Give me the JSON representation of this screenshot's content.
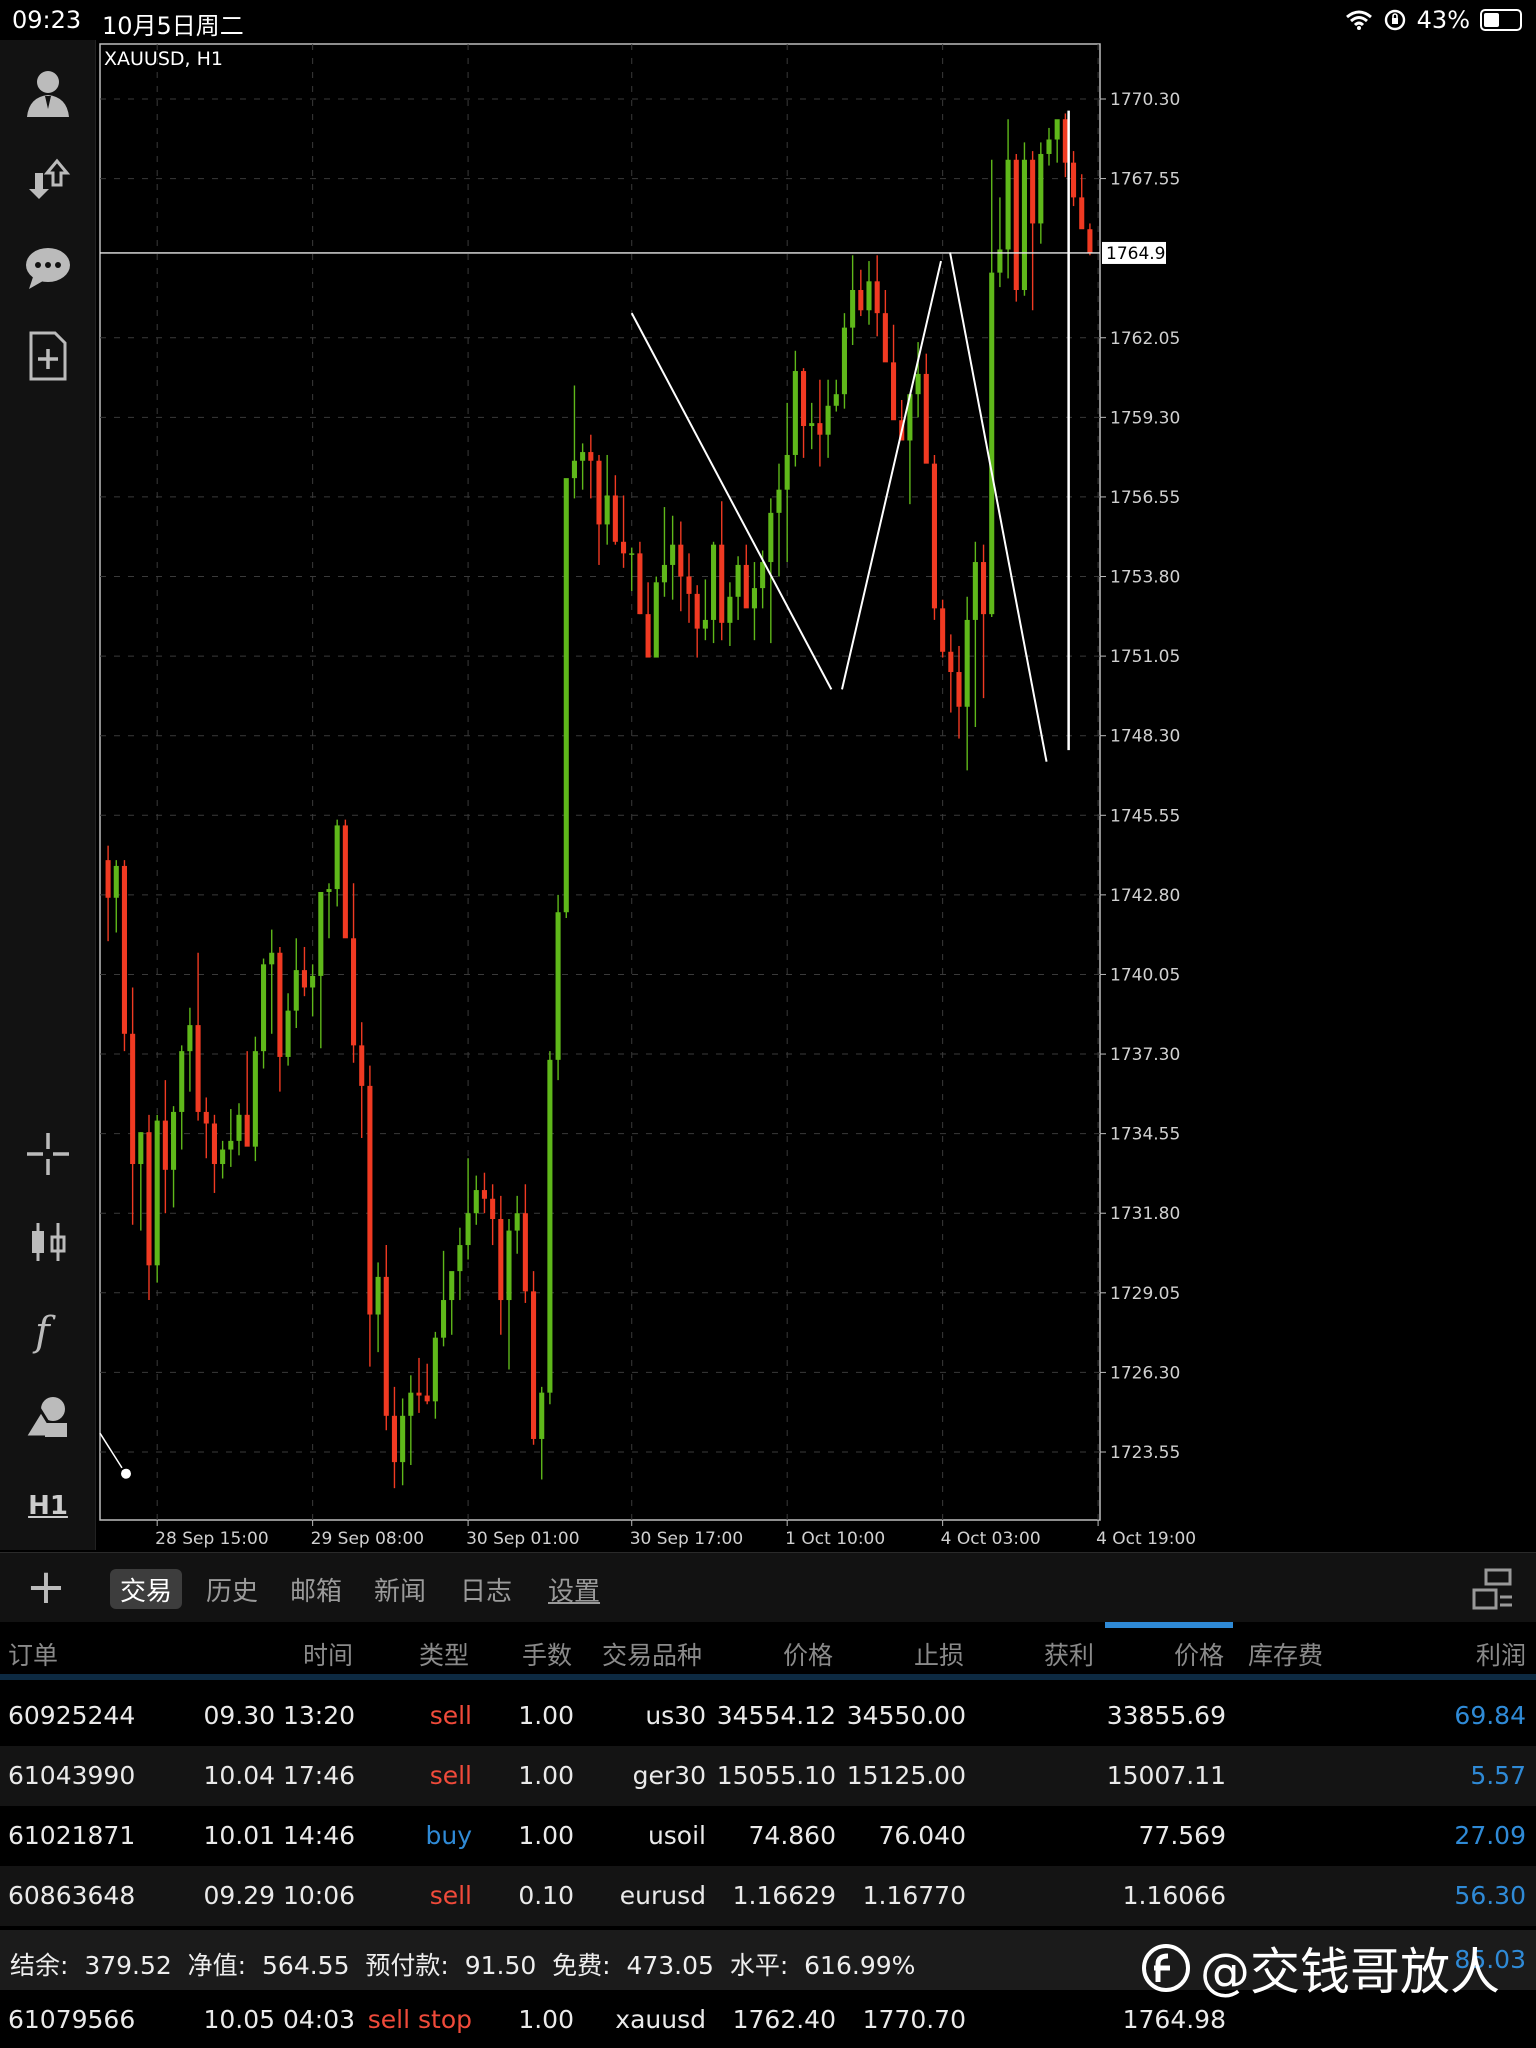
{
  "status_bar": {
    "time": "09:23",
    "date": "10月5日周二",
    "battery": "43%",
    "battery_level": 0.43
  },
  "toolbar": {
    "icons": [
      "account-icon",
      "trade-arrows-icon",
      "chat-icon",
      "new-document-icon",
      "crosshair-icon",
      "chart-type-icon",
      "indicator-icon",
      "objects-icon"
    ],
    "timeframe": "H1"
  },
  "chart": {
    "symbol_label": "XAUUSD, H1",
    "current_price_label": "1764.98"
  },
  "chart_data": {
    "type": "candlestick",
    "symbol": "XAUUSD",
    "timeframe": "H1",
    "y_ticks": [
      "1770.30",
      "1767.55",
      "1764.98",
      "1762.05",
      "1759.30",
      "1756.55",
      "1753.80",
      "1751.05",
      "1748.30",
      "1745.55",
      "1742.80",
      "1740.05",
      "1737.30",
      "1734.55",
      "1731.80",
      "1729.05",
      "1726.30",
      "1723.55"
    ],
    "x_ticks": [
      "28 Sep 15:00",
      "29 Sep 08:00",
      "30 Sep 01:00",
      "30 Sep 17:00",
      "1 Oct 10:00",
      "4 Oct 03:00",
      "4 Oct 19:00"
    ],
    "ylim": [
      1721.2,
      1772.2
    ],
    "current_price": 1764.98,
    "grid": true,
    "colors": {
      "up": "#5fb81a",
      "down": "#f03a22",
      "background": "#000000",
      "grid": "#3a3a3a",
      "axis_text": "#d0d0d0"
    },
    "candles": [
      [
        1744.0,
        1744.5,
        1741.2,
        1742.7
      ],
      [
        1742.7,
        1744.0,
        1741.5,
        1743.8
      ],
      [
        1743.8,
        1744.0,
        1737.4,
        1738.0
      ],
      [
        1738.0,
        1739.6,
        1731.4,
        1733.5
      ],
      [
        1733.5,
        1734.6,
        1731.2,
        1734.6
      ],
      [
        1734.6,
        1735.2,
        1728.8,
        1730.0
      ],
      [
        1730.0,
        1735.2,
        1729.4,
        1735.0
      ],
      [
        1735.0,
        1736.4,
        1731.8,
        1733.3
      ],
      [
        1733.3,
        1735.5,
        1732.0,
        1735.3
      ],
      [
        1735.3,
        1737.6,
        1734.0,
        1737.4
      ],
      [
        1737.4,
        1738.9,
        1736.0,
        1738.3
      ],
      [
        1738.3,
        1740.8,
        1735.0,
        1735.3
      ],
      [
        1735.3,
        1735.8,
        1733.7,
        1734.9
      ],
      [
        1734.9,
        1735.2,
        1732.5,
        1733.5
      ],
      [
        1733.5,
        1734.3,
        1733.0,
        1734.0
      ],
      [
        1734.0,
        1735.4,
        1733.4,
        1734.3
      ],
      [
        1734.3,
        1735.6,
        1733.8,
        1735.2
      ],
      [
        1735.2,
        1737.4,
        1734.7,
        1734.1
      ],
      [
        1734.1,
        1737.9,
        1733.6,
        1737.4
      ],
      [
        1737.4,
        1740.6,
        1736.8,
        1740.4
      ],
      [
        1740.4,
        1741.6,
        1738.0,
        1740.8
      ],
      [
        1740.8,
        1741.0,
        1736.0,
        1737.2
      ],
      [
        1737.2,
        1739.4,
        1736.9,
        1738.8
      ],
      [
        1738.8,
        1741.3,
        1738.2,
        1740.2
      ],
      [
        1740.2,
        1741.0,
        1739.3,
        1739.6
      ],
      [
        1739.6,
        1740.4,
        1738.6,
        1740.0
      ],
      [
        1740.0,
        1742.9,
        1737.5,
        1742.9
      ],
      [
        1742.9,
        1743.2,
        1741.3,
        1743.0
      ],
      [
        1743.0,
        1745.4,
        1742.4,
        1745.2
      ],
      [
        1745.2,
        1745.4,
        1741.7,
        1741.3
      ],
      [
        1741.3,
        1743.2,
        1737.0,
        1737.6
      ],
      [
        1737.6,
        1738.4,
        1734.4,
        1736.2
      ],
      [
        1736.2,
        1736.9,
        1726.5,
        1728.3
      ],
      [
        1728.3,
        1730.1,
        1727.0,
        1729.6
      ],
      [
        1729.6,
        1730.7,
        1724.3,
        1724.8
      ],
      [
        1724.8,
        1725.8,
        1722.3,
        1723.2
      ],
      [
        1723.2,
        1725.4,
        1722.4,
        1724.8
      ],
      [
        1724.8,
        1726.2,
        1723.1,
        1725.6
      ],
      [
        1725.6,
        1726.8,
        1724.9,
        1725.5
      ],
      [
        1725.5,
        1726.6,
        1725.2,
        1725.3
      ],
      [
        1725.3,
        1727.7,
        1724.7,
        1727.5
      ],
      [
        1727.5,
        1730.5,
        1727.2,
        1728.8
      ],
      [
        1728.8,
        1729.5,
        1727.6,
        1729.8
      ],
      [
        1729.8,
        1731.3,
        1728.8,
        1730.7
      ],
      [
        1730.7,
        1733.7,
        1730.2,
        1731.8
      ],
      [
        1731.8,
        1733.1,
        1731.4,
        1732.6
      ],
      [
        1732.6,
        1733.2,
        1731.8,
        1732.3
      ],
      [
        1732.3,
        1732.8,
        1730.7,
        1731.6
      ],
      [
        1731.6,
        1732.4,
        1727.6,
        1728.8
      ],
      [
        1728.8,
        1731.6,
        1726.4,
        1731.2
      ],
      [
        1731.2,
        1732.4,
        1730.4,
        1731.8
      ],
      [
        1731.8,
        1732.8,
        1728.7,
        1729.1
      ],
      [
        1729.1,
        1729.8,
        1723.8,
        1724.0
      ],
      [
        1724.0,
        1725.8,
        1722.6,
        1725.6
      ],
      [
        1725.6,
        1737.4,
        1725.2,
        1737.1
      ],
      [
        1737.1,
        1742.8,
        1736.4,
        1742.2
      ],
      [
        1742.2,
        1757.1,
        1742.0,
        1757.2
      ],
      [
        1757.2,
        1760.4,
        1756.5,
        1757.8
      ],
      [
        1757.8,
        1758.4,
        1756.8,
        1758.1
      ],
      [
        1758.1,
        1758.7,
        1756.5,
        1757.8
      ],
      [
        1757.8,
        1758.0,
        1754.2,
        1755.6
      ],
      [
        1755.6,
        1758.0,
        1754.9,
        1756.6
      ],
      [
        1756.6,
        1757.3,
        1754.9,
        1755.0
      ],
      [
        1755.0,
        1756.6,
        1754.1,
        1754.6
      ],
      [
        1754.6,
        1754.8,
        1753.3,
        1754.6
      ],
      [
        1754.6,
        1755.0,
        1752.5,
        1752.5
      ],
      [
        1752.5,
        1753.6,
        1751.8,
        1751.0
      ],
      [
        1751.0,
        1753.8,
        1751.5,
        1753.6
      ],
      [
        1753.6,
        1756.2,
        1753.1,
        1754.2
      ],
      [
        1754.2,
        1755.9,
        1753.0,
        1754.9
      ],
      [
        1754.9,
        1755.7,
        1752.6,
        1753.8
      ],
      [
        1753.8,
        1754.6,
        1752.2,
        1753.2
      ],
      [
        1753.2,
        1753.5,
        1751.0,
        1752.0
      ],
      [
        1752.0,
        1753.7,
        1751.6,
        1752.3
      ],
      [
        1752.3,
        1755.0,
        1751.5,
        1754.9
      ],
      [
        1754.9,
        1756.4,
        1751.6,
        1752.2
      ],
      [
        1752.2,
        1753.6,
        1751.4,
        1753.1
      ],
      [
        1753.1,
        1754.5,
        1752.3,
        1754.2
      ],
      [
        1754.2,
        1754.9,
        1752.8,
        1752.7
      ],
      [
        1752.7,
        1754.3,
        1751.6,
        1753.4
      ],
      [
        1753.4,
        1754.7,
        1752.7,
        1754.3
      ],
      [
        1754.3,
        1756.5,
        1751.5,
        1756.0
      ],
      [
        1756.0,
        1757.7,
        1753.8,
        1756.8
      ],
      [
        1756.8,
        1759.8,
        1754.3,
        1758.0
      ],
      [
        1758.0,
        1761.6,
        1757.6,
        1760.9
      ],
      [
        1760.9,
        1761.0,
        1757.9,
        1759.0
      ],
      [
        1759.0,
        1759.8,
        1758.2,
        1759.1
      ],
      [
        1759.1,
        1760.6,
        1757.6,
        1758.7
      ],
      [
        1758.7,
        1760.6,
        1757.9,
        1759.7
      ],
      [
        1759.7,
        1760.6,
        1759.5,
        1760.1
      ],
      [
        1760.1,
        1762.9,
        1759.6,
        1762.4
      ],
      [
        1762.4,
        1764.9,
        1761.8,
        1763.7
      ],
      [
        1763.7,
        1764.4,
        1762.8,
        1763.0
      ],
      [
        1763.0,
        1764.7,
        1762.5,
        1764.0
      ],
      [
        1764.0,
        1764.9,
        1762.1,
        1762.9
      ],
      [
        1762.9,
        1763.7,
        1761.5,
        1761.2
      ],
      [
        1761.2,
        1762.5,
        1759.8,
        1759.2
      ],
      [
        1759.2,
        1759.9,
        1758.6,
        1758.5
      ],
      [
        1758.5,
        1760.0,
        1756.3,
        1760.1
      ],
      [
        1760.1,
        1761.9,
        1759.3,
        1760.8
      ],
      [
        1760.8,
        1761.5,
        1758.2,
        1757.7
      ],
      [
        1757.7,
        1758.0,
        1752.3,
        1752.7
      ],
      [
        1752.7,
        1753.0,
        1751.0,
        1751.2
      ],
      [
        1751.2,
        1751.8,
        1749.1,
        1750.5
      ],
      [
        1750.5,
        1751.4,
        1748.2,
        1749.3
      ],
      [
        1749.3,
        1753.1,
        1747.1,
        1752.3
      ],
      [
        1752.3,
        1755.0,
        1748.6,
        1754.3
      ],
      [
        1754.3,
        1754.9,
        1749.6,
        1752.5
      ],
      [
        1752.5,
        1768.2,
        1752.4,
        1764.3
      ],
      [
        1764.3,
        1766.9,
        1763.8,
        1765.1
      ],
      [
        1765.1,
        1769.6,
        1764.1,
        1768.2
      ],
      [
        1768.2,
        1768.4,
        1763.3,
        1763.7
      ],
      [
        1763.7,
        1768.8,
        1763.5,
        1768.2
      ],
      [
        1768.2,
        1768.5,
        1763.0,
        1766.0
      ],
      [
        1766.0,
        1768.8,
        1765.3,
        1768.4
      ],
      [
        1768.4,
        1769.3,
        1768.0,
        1768.9
      ],
      [
        1768.9,
        1769.5,
        1768.1,
        1769.6
      ],
      [
        1769.6,
        1769.8,
        1767.6,
        1768.1
      ],
      [
        1768.1,
        1768.5,
        1766.6,
        1766.9
      ],
      [
        1766.9,
        1767.7,
        1765.9,
        1765.8
      ],
      [
        1765.8,
        1766.0,
        1764.9,
        1764.98
      ]
    ],
    "drawn_lines": [
      {
        "from": [
          "30 Sep 17:00",
          1762.9
        ],
        "to": [
          "1 Oct 10:00+",
          1749.9
        ]
      },
      {
        "from": [
          "1 Oct 10:00+",
          1749.9
        ],
        "to": [
          "4 Oct 03:00-",
          1764.7
        ]
      },
      {
        "from": [
          "4 Oct 03:00",
          1765.0
        ],
        "to": [
          "4 Oct 03:00+",
          1747.4
        ]
      },
      {
        "vertical_at": "4 Oct 19:00-",
        "from_price": 1769.9,
        "to_price": 1747.8
      }
    ]
  },
  "bottom_tabs": {
    "add": "+",
    "items": [
      {
        "label": "交易",
        "active": true
      },
      {
        "label": "历史"
      },
      {
        "label": "邮箱"
      },
      {
        "label": "新闻"
      },
      {
        "label": "日志"
      },
      {
        "label": "设置"
      }
    ]
  },
  "table": {
    "headers": {
      "order": "订单",
      "time": "时间",
      "type": "类型",
      "volume": "手数",
      "symbol": "交易品种",
      "price": "价格",
      "sl": "止损",
      "tp": "获利",
      "current_price": "价格",
      "swap": "库存费",
      "profit": "利润"
    },
    "rows": [
      {
        "order": "60925244",
        "time": "09.30 13:20",
        "type": "sell",
        "volume": "1.00",
        "symbol": "us30",
        "price": "34554.12",
        "sl": "34550.00",
        "tp": "",
        "current_price": "33855.69",
        "swap": "",
        "profit": "69.84"
      },
      {
        "order": "61043990",
        "time": "10.04 17:46",
        "type": "sell",
        "volume": "1.00",
        "symbol": "ger30",
        "price": "15055.10",
        "sl": "15125.00",
        "tp": "",
        "current_price": "15007.11",
        "swap": "",
        "profit": "5.57"
      },
      {
        "order": "61021871",
        "time": "10.01 14:46",
        "type": "buy",
        "volume": "1.00",
        "symbol": "usoil",
        "price": "74.860",
        "sl": "76.040",
        "tp": "",
        "current_price": "77.569",
        "swap": "",
        "profit": "27.09"
      },
      {
        "order": "60863648",
        "time": "09.29 10:06",
        "type": "sell",
        "volume": "0.10",
        "symbol": "eurusd",
        "price": "1.16629",
        "sl": "1.16770",
        "tp": "",
        "current_price": "1.16066",
        "swap": "",
        "profit": "56.30"
      }
    ],
    "summary": {
      "text": "结余:  379.52  净值:  564.55  预付款:  91.50  免费:  473.05  水平:  616.99%",
      "profit": "85.03"
    },
    "pending": {
      "order": "61079566",
      "time": "10.05 04:03",
      "type": "sell stop",
      "volume": "1.00",
      "symbol": "xauusd",
      "price": "1762.40",
      "sl": "1770.70",
      "tp": "",
      "current_price": "1764.98"
    }
  },
  "watermark": {
    "text": "@交钱哥放人"
  }
}
